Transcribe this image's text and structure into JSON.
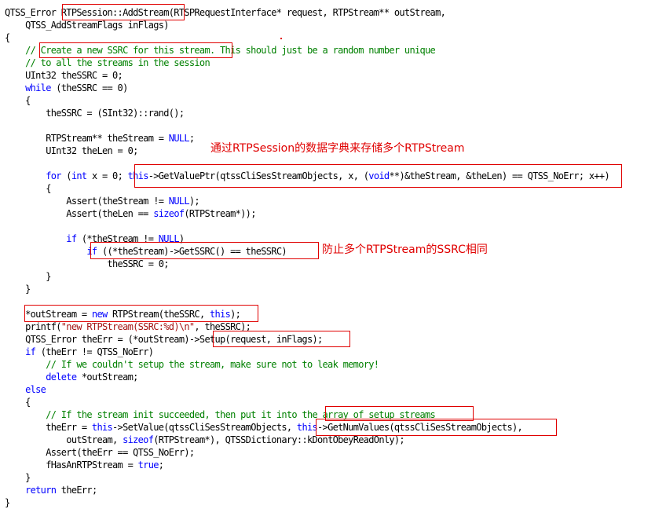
{
  "code": {
    "lines": [
      [
        {
          "t": "QTSS_Error RTPSession::AddStream(RTSPRequestInterface* request, RTPStream** outStream,",
          "c": ""
        }
      ],
      [
        {
          "t": "    QTSS_AddStreamFlags inFlags)",
          "c": ""
        }
      ],
      [
        {
          "t": "{",
          "c": ""
        }
      ],
      [
        {
          "t": "    // Create a new SSRC for this stream. This should just be a random number unique",
          "c": "cm"
        }
      ],
      [
        {
          "t": "    // to all the streams in the session",
          "c": "cm"
        }
      ],
      [
        {
          "t": "    UInt32 theSSRC = 0;",
          "c": ""
        }
      ],
      [
        {
          "t": "    ",
          "c": ""
        },
        {
          "t": "while",
          "c": "kw"
        },
        {
          "t": " (theSSRC == 0)",
          "c": ""
        }
      ],
      [
        {
          "t": "    {",
          "c": ""
        }
      ],
      [
        {
          "t": "        theSSRC = (SInt32)::rand();",
          "c": ""
        }
      ],
      [
        {
          "t": "",
          "c": ""
        }
      ],
      [
        {
          "t": "        RTPStream** theStream = ",
          "c": ""
        },
        {
          "t": "NULL",
          "c": "kw"
        },
        {
          "t": ";",
          "c": ""
        }
      ],
      [
        {
          "t": "        UInt32 theLen = 0;",
          "c": ""
        }
      ],
      [
        {
          "t": "",
          "c": ""
        }
      ],
      [
        {
          "t": "        ",
          "c": ""
        },
        {
          "t": "for",
          "c": "kw"
        },
        {
          "t": " (",
          "c": ""
        },
        {
          "t": "int",
          "c": "kw"
        },
        {
          "t": " x = 0; ",
          "c": ""
        },
        {
          "t": "this",
          "c": "kw"
        },
        {
          "t": "->GetValuePtr(qtssCliSesStreamObjects, x, (",
          "c": ""
        },
        {
          "t": "void",
          "c": "kw"
        },
        {
          "t": "**)&theStream, &theLen) == QTSS_NoErr; x++)",
          "c": ""
        }
      ],
      [
        {
          "t": "        {",
          "c": ""
        }
      ],
      [
        {
          "t": "            Assert(theStream != ",
          "c": ""
        },
        {
          "t": "NULL",
          "c": "kw"
        },
        {
          "t": ");",
          "c": ""
        }
      ],
      [
        {
          "t": "            Assert(theLen == ",
          "c": ""
        },
        {
          "t": "sizeof",
          "c": "kw"
        },
        {
          "t": "(RTPStream*));",
          "c": ""
        }
      ],
      [
        {
          "t": "",
          "c": ""
        }
      ],
      [
        {
          "t": "            ",
          "c": ""
        },
        {
          "t": "if",
          "c": "kw"
        },
        {
          "t": " (*theStream != ",
          "c": ""
        },
        {
          "t": "NULL",
          "c": "kw"
        },
        {
          "t": ")",
          "c": ""
        }
      ],
      [
        {
          "t": "                ",
          "c": ""
        },
        {
          "t": "if",
          "c": "kw"
        },
        {
          "t": " ((*theStream)->GetSSRC() == theSSRC)",
          "c": ""
        }
      ],
      [
        {
          "t": "                    theSSRC = 0;",
          "c": ""
        }
      ],
      [
        {
          "t": "        }",
          "c": ""
        }
      ],
      [
        {
          "t": "    }",
          "c": ""
        }
      ],
      [
        {
          "t": "",
          "c": ""
        }
      ],
      [
        {
          "t": "    *outStream = ",
          "c": ""
        },
        {
          "t": "new",
          "c": "kw"
        },
        {
          "t": " RTPStream(theSSRC, ",
          "c": ""
        },
        {
          "t": "this",
          "c": "kw"
        },
        {
          "t": ");",
          "c": ""
        }
      ],
      [
        {
          "t": "    printf(",
          "c": ""
        },
        {
          "t": "\"new RTPStream(SSRC:%d)\\n\"",
          "c": "str"
        },
        {
          "t": ", theSSRC);",
          "c": ""
        }
      ],
      [
        {
          "t": "    QTSS_Error theErr = (*outStream)->Setup(request, inFlags);",
          "c": ""
        }
      ],
      [
        {
          "t": "    ",
          "c": ""
        },
        {
          "t": "if",
          "c": "kw"
        },
        {
          "t": " (theErr != QTSS_NoErr)",
          "c": ""
        }
      ],
      [
        {
          "t": "        ",
          "c": ""
        },
        {
          "t": "// If we couldn't setup the stream, make sure not to leak memory!",
          "c": "cm"
        }
      ],
      [
        {
          "t": "        ",
          "c": ""
        },
        {
          "t": "delete",
          "c": "kw"
        },
        {
          "t": " *outStream;",
          "c": ""
        }
      ],
      [
        {
          "t": "    ",
          "c": ""
        },
        {
          "t": "else",
          "c": "kw"
        }
      ],
      [
        {
          "t": "    {",
          "c": ""
        }
      ],
      [
        {
          "t": "        ",
          "c": ""
        },
        {
          "t": "// If the stream init succeeded, then put it into the array of setup streams",
          "c": "cm"
        }
      ],
      [
        {
          "t": "        theErr = ",
          "c": ""
        },
        {
          "t": "this",
          "c": "kw"
        },
        {
          "t": "->SetValue(qtssCliSesStreamObjects, ",
          "c": ""
        },
        {
          "t": "this",
          "c": "kw"
        },
        {
          "t": "->GetNumValues(qtssCliSesStreamObjects),",
          "c": ""
        }
      ],
      [
        {
          "t": "            outStream, ",
          "c": ""
        },
        {
          "t": "sizeof",
          "c": "kw"
        },
        {
          "t": "(RTPStream*), QTSSDictionary::kDontObeyReadOnly);",
          "c": ""
        }
      ],
      [
        {
          "t": "        Assert(theErr == QTSS_NoErr);",
          "c": ""
        }
      ],
      [
        {
          "t": "        fHasAnRTPStream = ",
          "c": ""
        },
        {
          "t": "true",
          "c": "kw"
        },
        {
          "t": ";",
          "c": ""
        }
      ],
      [
        {
          "t": "    }",
          "c": ""
        }
      ],
      [
        {
          "t": "    ",
          "c": ""
        },
        {
          "t": "return",
          "c": "kw"
        },
        {
          "t": " theErr;",
          "c": ""
        }
      ],
      [
        {
          "t": "}",
          "c": ""
        }
      ]
    ]
  },
  "annotations": {
    "note_dictionary": "通过RTPSession的数据字典来存储多个RTPStream",
    "note_ssrc": "防止多个RTPStream的SSRC相同"
  },
  "colors": {
    "keyword": "#0000ff",
    "comment": "#008000",
    "string": "#a31515",
    "annotation": "#e00000",
    "background": "#ffffff"
  }
}
